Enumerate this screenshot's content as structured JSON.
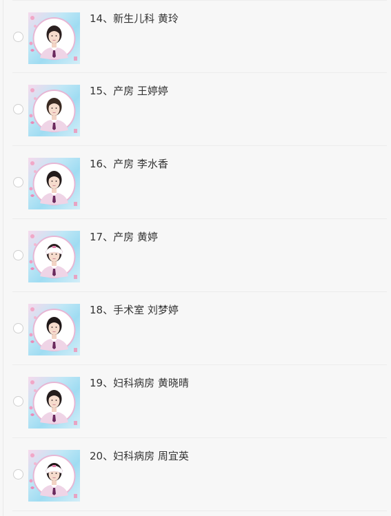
{
  "items": [
    {
      "label": "14、新生儿科 黄玲",
      "hair": "#2b2020",
      "cap": false
    },
    {
      "label": "15、产房 王婷婷",
      "hair": "#3a2a22",
      "cap": false
    },
    {
      "label": "16、产房 李水香",
      "hair": "#231b1b",
      "cap": false
    },
    {
      "label": "17、产房 黄婷",
      "hair": "#2a2020",
      "cap": true
    },
    {
      "label": "18、手术室 刘梦婷",
      "hair": "#1f1818",
      "cap": false
    },
    {
      "label": "19、妇科病房 黄晓晴",
      "hair": "#241c1c",
      "cap": false
    },
    {
      "label": "20、妇科病房 周宜英",
      "hair": "#1e1717",
      "cap": true
    }
  ]
}
